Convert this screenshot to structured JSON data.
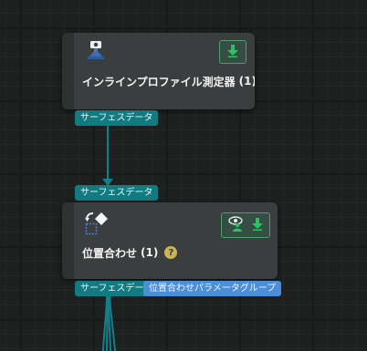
{
  "nodes": [
    {
      "title": "インラインプロファイル測定器",
      "count": "(1)",
      "help": "?",
      "icon": "camera-on-stand-icon",
      "status_icons": [
        "download-arrow-icon"
      ]
    },
    {
      "title": "位置合わせ",
      "count": "(1)",
      "help": "?",
      "icon": "alignment-icon",
      "status_icons": [
        "eye-person-icon",
        "download-arrow-icon"
      ]
    }
  ],
  "ports": {
    "node1_output": "サーフェスデータ",
    "node2_input": "サーフェスデータ",
    "node2_output_1": "サーフェスデータ",
    "node2_output_2": "位置合わせパラメータグループ"
  },
  "colors": {
    "port_teal": "#127b82",
    "port_blue": "#4a8fd8",
    "edge": "#12808a",
    "node_bg": "#3b3e3e",
    "status_green": "#27c462"
  }
}
